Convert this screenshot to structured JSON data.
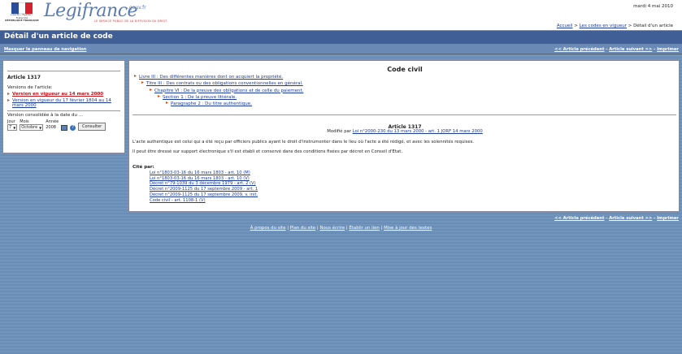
{
  "header": {
    "flag_text": [
      "Liberté • Égalité • Fraternité",
      "RÉPUBLIQUE FRANÇAISE"
    ],
    "logo_word": "Legifrance",
    "logo_gouv": ".gouv.fr",
    "tagline": "LE SERVICE PUBLIC DE LA DIFFUSION DU DROIT",
    "date": "mardi 4 mai 2010",
    "breadcrumb": [
      "Accueil",
      "Les codes en vigueur",
      "Détail d'un article"
    ]
  },
  "titlebar": {
    "title": "Détail d'un article de code"
  },
  "subbar": {
    "hide_panel": "Masquer le panneau de navigation",
    "prev": "<< Article précédent",
    "next": "Article suivant >>",
    "print": "Imprimer"
  },
  "left": {
    "article": "Article 1317",
    "versions_label": "Versions de l'article:",
    "versions": [
      "Version en vigueur au 14 mars 2000",
      "Version en vigueur du 17 février 1804 au 14 mars 2000"
    ],
    "consolidated_label": "Version consolidée à la date du ...",
    "day_label": "Jour",
    "month_label": "Mois",
    "year_label": "Année",
    "day_value": "7",
    "month_value": "Octobre",
    "year_value": "2008",
    "submit": "Consulter"
  },
  "main": {
    "code_title": "Code civil",
    "toc": [
      "Livre III : Des différentes manières dont on acquiert la propriété.",
      "Titre III : Des contrats ou des obligations conventionnelles en général.",
      "Chapitre VI : De la preuve des obligations et de celle du paiement.",
      "Section 1 : De la preuve littérale.",
      "Paragraphe 2 : Du titre authentique."
    ],
    "article_title": "Article 1317",
    "modified_prefix": "Modifié par",
    "modified_link": "Loi n°2000-230 du 13 mars 2000 - art. 1 JORF 14 mars 2000",
    "text1": "L'acte authentique est celui qui a été reçu par officiers publics ayant le droit d'instrumenter dans le lieu où l'acte a été rédigé, et avec les solennités requises.",
    "text2": "Il peut être dressé sur support électronique s'il est établi et conservé dans des conditions fixées par décret en Conseil d'Etat.",
    "cite_label": "Cité par:",
    "cites": [
      "Loi n°1803-03-16 du 16 mars 1803 - art. 10 (M)",
      "Loi n°1803-03-16 du 16 mars 1803 - art. 10 (V)",
      "Décret n°79-1039 du 3 décembre 1979 - art. 2 (V)",
      "Décret n°2009-1125 du 17 septembre 2009 - art. 1",
      "Décret n°2009-1125 du 17 septembre 2009, v. init.",
      "Code civil - art. 1108-1 (V)"
    ]
  },
  "footer": {
    "links": [
      "À propos du site",
      "Plan du site",
      "Nous écrire",
      "Établir un lien",
      "Mise à jour des textes"
    ]
  }
}
